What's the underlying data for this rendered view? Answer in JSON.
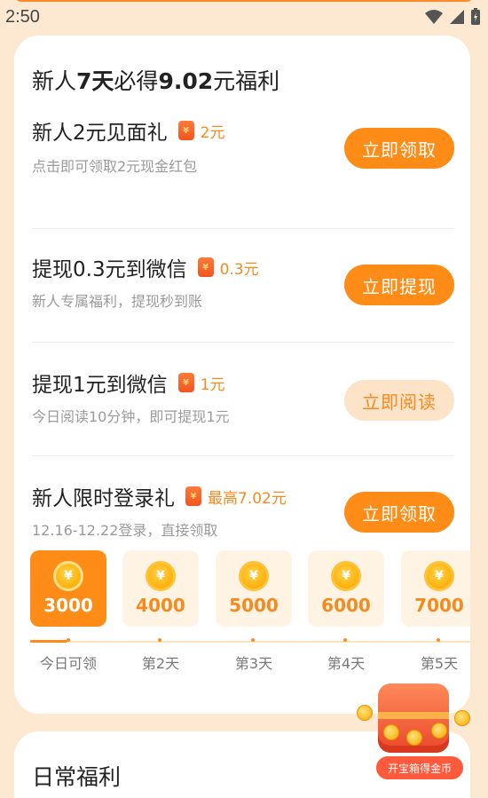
{
  "status": {
    "time": "2:50"
  },
  "newbie": {
    "title_prefix": "新人",
    "title_days": "7天",
    "title_mid": "必得",
    "title_amount": "9.02",
    "title_suffix": "元福利",
    "tasks": [
      {
        "title": "新人2元见面礼",
        "reward": "2元",
        "desc": "点击即可领取2元现金红包",
        "button": "立即领取",
        "enabled": true
      },
      {
        "title": "提现0.3元到微信",
        "reward": "0.3元",
        "desc": "新人专属福利，提现秒到账",
        "button": "立即提现",
        "enabled": true
      },
      {
        "title": "提现1元到微信",
        "reward": "1元",
        "desc": "今日阅读10分钟，即可提现1元",
        "button": "立即阅读",
        "enabled": false
      },
      {
        "title": "新人限时登录礼",
        "reward": "最高7.02元",
        "desc": "12.16-12.22登录，直接领取",
        "button": "立即领取",
        "enabled": true
      }
    ],
    "days": [
      {
        "amount": "3000",
        "label": "今日可领",
        "active": true
      },
      {
        "amount": "4000",
        "label": "第2天",
        "active": false
      },
      {
        "amount": "5000",
        "label": "第3天",
        "active": false
      },
      {
        "amount": "6000",
        "label": "第4天",
        "active": false
      },
      {
        "amount": "7000",
        "label": "第5天",
        "active": false
      }
    ],
    "coin_symbol": "¥"
  },
  "treasure": {
    "label": "开宝箱得金币"
  },
  "daily": {
    "title": "日常福利"
  },
  "colors": {
    "accent": "#ff8c16",
    "reward": "#f58a1f",
    "background": "#fde9d2"
  }
}
